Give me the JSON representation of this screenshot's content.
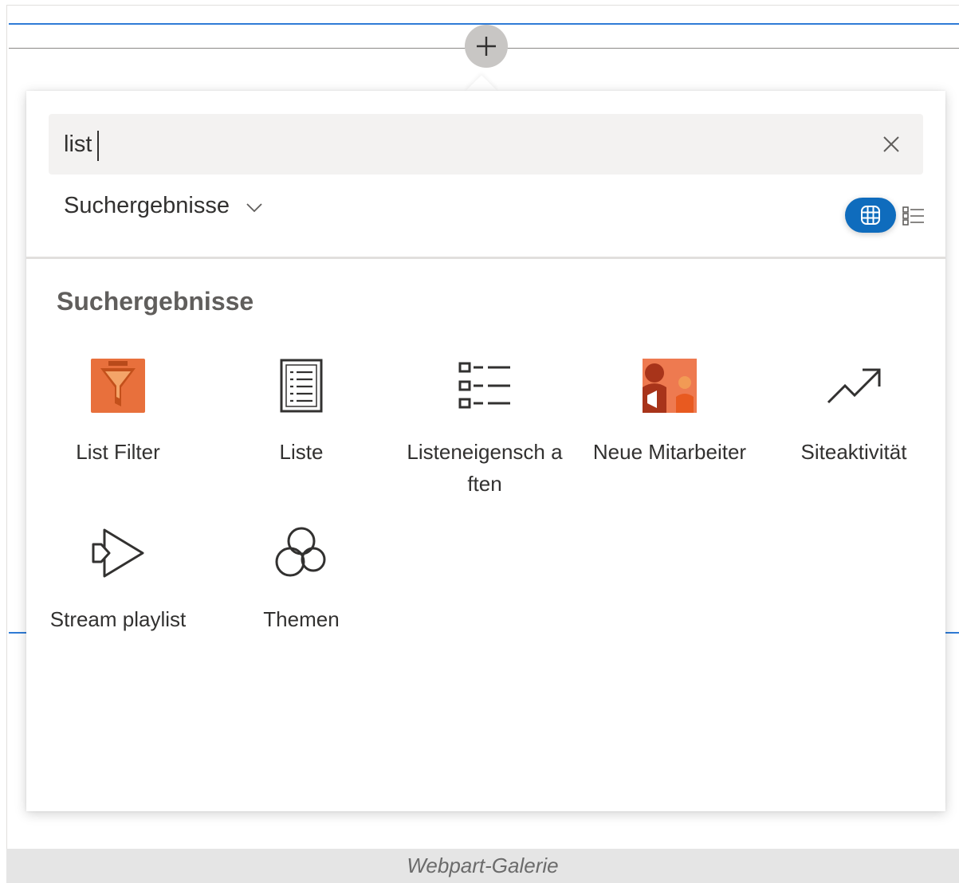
{
  "search": {
    "value": "list",
    "placeholder": ""
  },
  "category": {
    "label": "Suchergebnisse"
  },
  "section": {
    "title": "Suchergebnisse"
  },
  "tiles": [
    {
      "label": "List Filter",
      "icon": "list-filter-icon"
    },
    {
      "label": "Liste",
      "icon": "list-document-icon"
    },
    {
      "label": "Listeneigensch aften",
      "icon": "list-properties-icon"
    },
    {
      "label": "Neue Mitarbeiter",
      "icon": "new-employees-icon"
    },
    {
      "label": "Siteaktivität",
      "icon": "trending-arrow-icon"
    },
    {
      "label": "Stream playlist",
      "icon": "stream-playlist-icon"
    },
    {
      "label": "Themen",
      "icon": "topics-icon"
    }
  ],
  "caption": "Webpart-Galerie",
  "colors": {
    "accent": "#0f6cbd",
    "section_line": "#2f7bd6",
    "orange": "#e8603c"
  }
}
